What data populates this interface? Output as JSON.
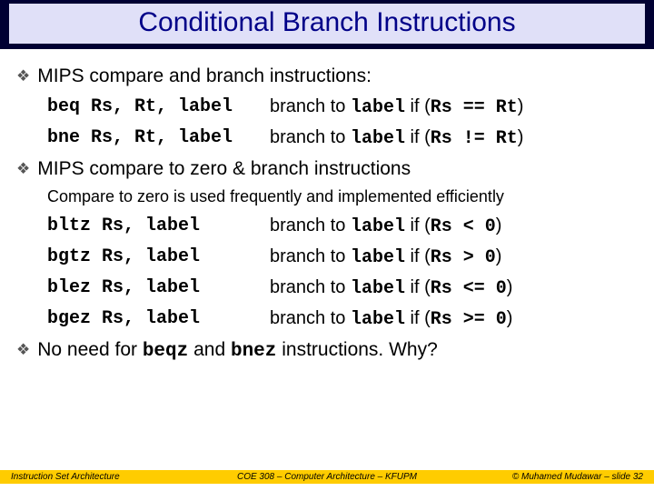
{
  "title": "Conditional Branch Instructions",
  "bullet1": "MIPS compare and branch instructions:",
  "row1": {
    "instr": "beq  Rs, Rt, label",
    "desc_pre": "branch to ",
    "desc_label": "label",
    "desc_mid": " if (",
    "desc_cond": "Rs == Rt",
    "desc_post": ")"
  },
  "row2": {
    "instr": "bne  Rs, Rt, label",
    "desc_pre": "branch to ",
    "desc_label": "label",
    "desc_mid": " if (",
    "desc_cond": "Rs != Rt",
    "desc_post": ")"
  },
  "bullet2": "MIPS compare to zero & branch instructions",
  "subnote": "Compare to zero is used frequently and implemented efficiently",
  "zrows": [
    {
      "instr": "bltz  Rs, label",
      "cond": "Rs < 0"
    },
    {
      "instr": "bgtz  Rs, label",
      "cond": "Rs > 0"
    },
    {
      "instr": "blez  Rs, label",
      "cond": "Rs <= 0"
    },
    {
      "instr": "bgez  Rs, label",
      "cond": "Rs >= 0"
    }
  ],
  "desc_pre": "branch to ",
  "desc_label": "label",
  "desc_mid": " if (",
  "desc_post": ")",
  "bullet3_pre": "No need for ",
  "bullet3_c1": "beqz",
  "bullet3_mid": " and ",
  "bullet3_c2": "bnez",
  "bullet3_post": " instructions. Why?",
  "footer": {
    "left": "Instruction Set Architecture",
    "center": "COE 308 – Computer Architecture – KFUPM",
    "right": "© Muhamed Mudawar – slide 32"
  }
}
